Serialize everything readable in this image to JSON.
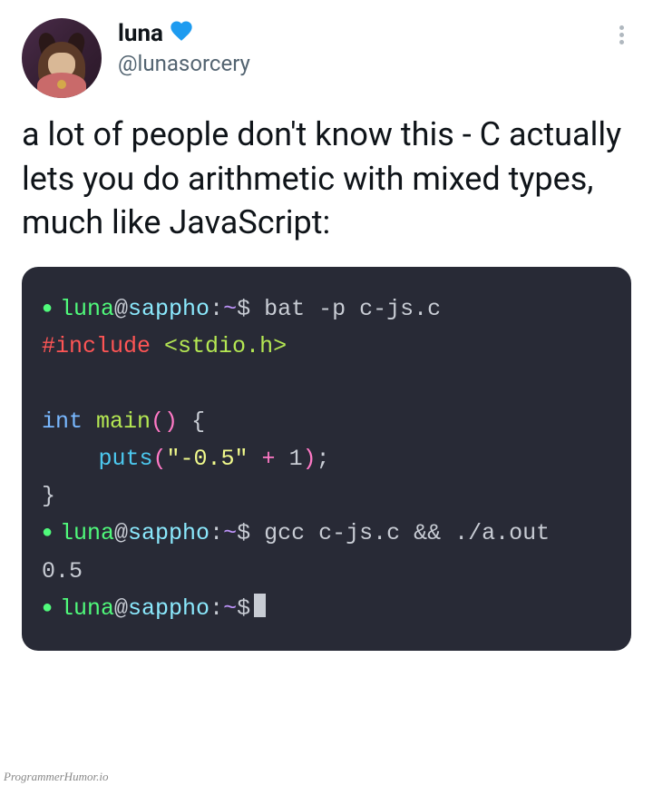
{
  "user": {
    "display_name": "luna",
    "handle": "@lunasorcery"
  },
  "tweet_text": "a lot of people don't know this - C actually lets you do arithmetic with mixed types, much like JavaScript:",
  "terminal": {
    "prompt": {
      "bullet": "●",
      "user": "luna",
      "at": "@",
      "host": "sappho",
      "sep": ":",
      "path": "~",
      "symbol": "$"
    },
    "cmd1": "bat -p c-js.c",
    "code": {
      "include": "#include",
      "header": "<stdio.h>",
      "kw_int": "int",
      "main": "main",
      "paren_lr": "()",
      "brace_open": " {",
      "puts": "puts",
      "paren_open": "(",
      "string": "\"-0.5\"",
      "plus": " + ",
      "one": "1",
      "paren_close": ")",
      "semi": ";",
      "brace_close": "}"
    },
    "cmd2": "gcc c-js.c && ./a.out",
    "output": "0.5"
  },
  "watermark": "ProgrammerHumor.io"
}
